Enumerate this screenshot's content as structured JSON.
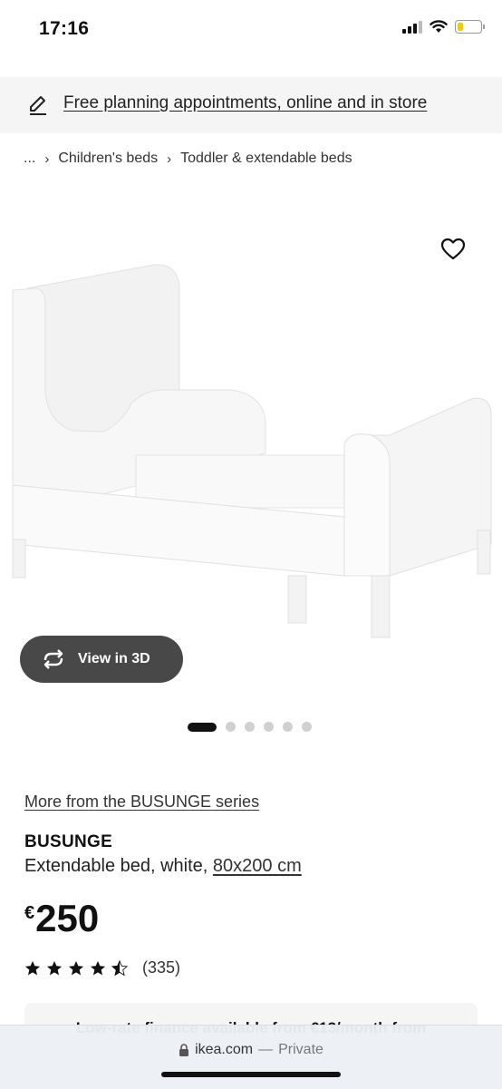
{
  "status_bar": {
    "time": "17:16",
    "icons": [
      "cellular-signal-icon",
      "wifi-icon",
      "battery-icon"
    ],
    "battery_color": "#f5cc00"
  },
  "banner": {
    "icon": "pencil-icon",
    "text": "Free planning appointments, online and in store"
  },
  "breadcrumb": {
    "items": [
      "...",
      "Children's beds",
      "Toddler & extendable beds"
    ]
  },
  "product_image": {
    "icon_favorite": "heart-icon",
    "view_3d_label": "View in 3D",
    "view_3d_icon": "rotate-arrows-icon",
    "carousel_total": 6,
    "carousel_active_index": 0
  },
  "product": {
    "series_link": "More from the BUSUNGE series",
    "name": "BUSUNGE",
    "description": "Extendable bed, white, ",
    "size": "80x200 cm",
    "price_currency": "€",
    "price": "250",
    "rating": 4.5,
    "rating_count": "(335)"
  },
  "finance": {
    "text": "Low-rate finance available from €13/month from"
  },
  "url_bar": {
    "domain": "ikea.com",
    "separator": "—",
    "mode": "Private"
  },
  "colors": {
    "button_dark": "#484848",
    "banner_bg": "#f5f5f5",
    "text": "#111111"
  }
}
